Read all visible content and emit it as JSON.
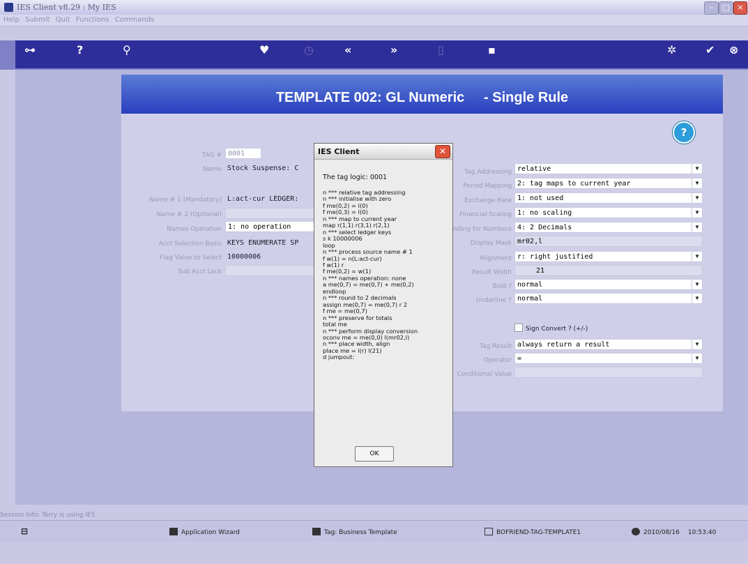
{
  "window": {
    "title": "IES Client v8.29 : My IES"
  },
  "menu": [
    "Help",
    "Submit",
    "Quit",
    "Functions",
    "Commands"
  ],
  "header": {
    "title": "TEMPLATE 002: GL Numeric     - Single Rule"
  },
  "form_left": {
    "tag_label": "TAG #",
    "tag_value": "0001",
    "name_label": "Name",
    "name_value": "Stock Suspense: C",
    "name1_label": "Name # 1 (Mandatory)",
    "name1_value": "L:act-cur LEDGER:",
    "name2_label": "Name # 2 (Optional)",
    "names_op_label": "Names Operation",
    "names_op_value": "1: no operation",
    "acct_basis_label": "Acct Selection Basis",
    "acct_basis_value": "KEYS ENUMERATE SP",
    "flag_label": "Flag Value to Select",
    "flag_value": "10000006",
    "sub_acct_label": "Sub Acct Lock"
  },
  "form_right": {
    "tag_addr_label": "Tag Addressing",
    "tag_addr_value": "relative",
    "period_label": "Period Mapping",
    "period_value": "2: tag maps to current year",
    "exchange_label": "Exchange Rate",
    "exchange_value": "1: not used",
    "fin_scaling_label": "Financial Scaling",
    "fin_scaling_value": "1: no scaling",
    "numbers_label": "Rounding for Numbers",
    "numbers_value": "4: 2 Decimals",
    "mask_label": "Display Mask",
    "mask_value": "mr02,l",
    "align_label": "Alignment",
    "align_value": "r: right justified",
    "width_label": "Result Width",
    "width_value": "21",
    "bold_label": "Bold ?",
    "bold_value": "normal",
    "underline_label": "Underline ?",
    "underline_value": "normal",
    "sign_label": "Sign Convert ? (+/-)",
    "result_label": "Tag Result",
    "result_value": "always return a result",
    "operator_label": "Operator",
    "operator_value": "=",
    "cond_label": "Conditional Value"
  },
  "dialog": {
    "title": "IES Client",
    "heading": "The tag logic: 0001",
    "lines": [
      "n *** relative tag addressing",
      "n *** initialise with zero",
      "f me(0,2) = l(0)",
      "f me(0,3) = l(0)",
      "n *** map to current year",
      "map r(1,1) r(3,1) r(2,1)",
      "n *** select ledger keys",
      "s k 10000006",
      "loop",
      "n *** process source name # 1",
      "f w(1) = n(L:act-cur)",
      "f w(1) r",
      "f me(0,2) = w(1)",
      "n *** names operation: none",
      "a me(0,7) = me(0,7) + me(0,2)",
      "endloop",
      "n *** round to 2 decimals",
      "assign me(0,7) = me(0,7) r 2",
      "f me = me(0,7)",
      "n *** preserve for totals",
      "total me",
      "n *** perform display conversion",
      "oconv me = me(0,0) l(mr02,l)",
      "n *** place width, align",
      "place me = l(r) l(21)",
      "d jumpout:"
    ],
    "ok_label": "OK"
  },
  "status": {
    "text": "Session Info: Terry is using IES"
  },
  "taskbar": {
    "app_wizard": "Application Wizard",
    "business_template": "Tag: Business Template",
    "tag_template": "BOFRIEND-TAG-TEMPLATE1",
    "date": "2010/08/16",
    "time": "10:53:40"
  }
}
